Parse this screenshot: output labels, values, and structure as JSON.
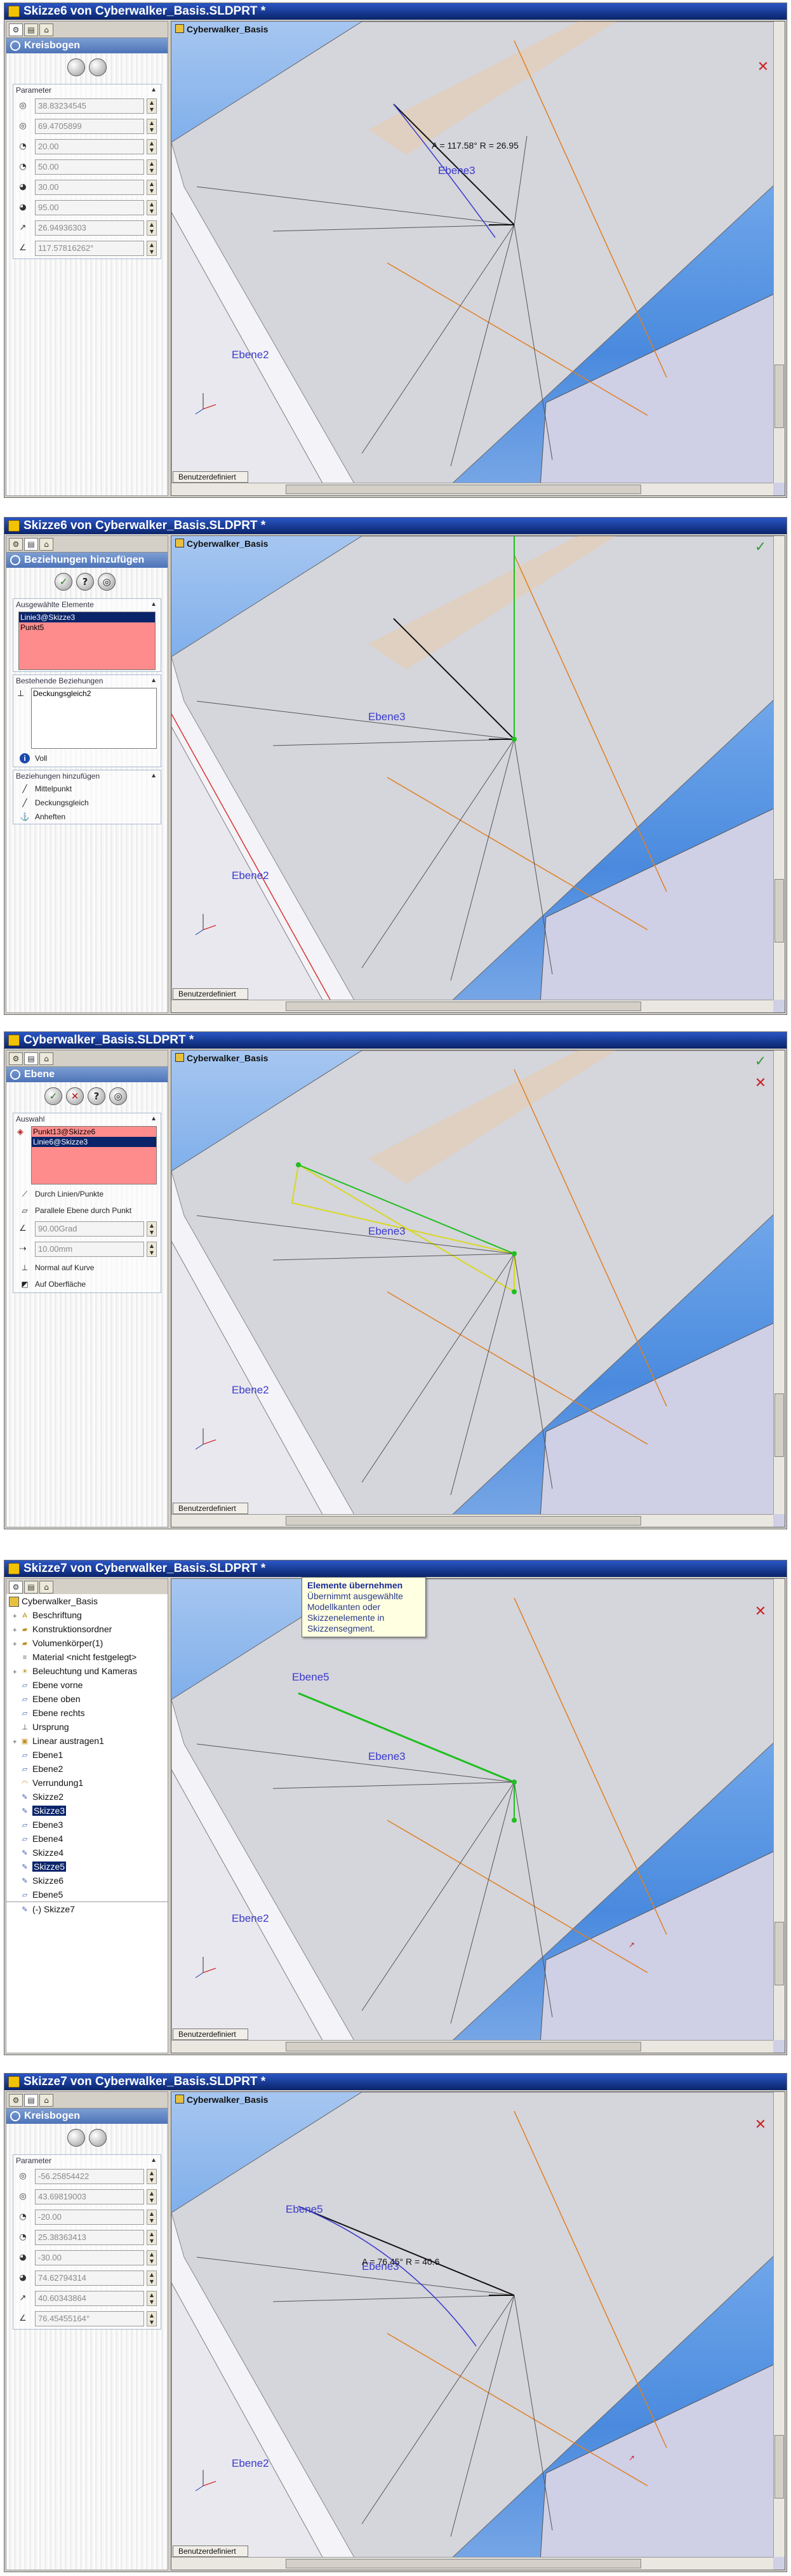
{
  "colors": {
    "title_bar": "#0a246a",
    "viewport_sky": "#6aa2e8",
    "model_gray": "#d9d9e0",
    "plane_blue": "#3a3acc",
    "sketch_orange": "#e08020",
    "selection_pink": "#ff8c8c",
    "selection_blue": "#0a246a",
    "confirm_green": "#3a9a3a",
    "cancel_red": "#cc2222"
  },
  "icons": {
    "app": "solidworks-part-icon",
    "confirm": "green-check-icon",
    "cancel": "red-x-icon",
    "help": "question-icon"
  },
  "windows": [
    {
      "title": "Skizze6 von Cyberwalker_Basis.SLDPRT *",
      "panel_title": "Kreisbogen",
      "group_title": "Parameter",
      "params": [
        "38.83234545",
        "69.4705899",
        "20.00",
        "50.00",
        "30.00",
        "95.00",
        "26.94936303",
        "117.57816262°"
      ],
      "viewport_label": "Cyberwalker_Basis",
      "dimension": "A = 117.58° R = 26.95",
      "plane_top": "Ebene3",
      "plane_bottom": "Ebene2",
      "view_tab": "Benutzerdefiniert"
    },
    {
      "title": "Skizze6 von Cyberwalker_Basis.SLDPRT *",
      "panel_title": "Beziehungen hinzufügen",
      "sel_group": "Ausgewählte Elemente",
      "sel_items": [
        "Linie3@Skizze3",
        "Punkt5"
      ],
      "exist_group": "Bestehende Beziehungen",
      "exist_items": [
        "Deckungsgleich2"
      ],
      "status": "Voll",
      "add_group": "Beziehungen hinzufügen",
      "add_items": [
        "Mittelpunkt",
        "Deckungsgleich",
        "Anheften"
      ],
      "viewport_label": "Cyberwalker_Basis",
      "plane_top": "Ebene3",
      "plane_bottom": "Ebene2",
      "view_tab": "Benutzerdefiniert"
    },
    {
      "title": "Cyberwalker_Basis.SLDPRT *",
      "panel_title": "Ebene",
      "sel_group": "Auswahl",
      "sel_items": [
        "Punkt13@Skizze6",
        "Linie6@Skizze3"
      ],
      "options": [
        "Durch Linien/Punkte",
        "Parallele Ebene durch Punkt"
      ],
      "fields": [
        "90.00Grad",
        "10.00mm"
      ],
      "options2": [
        "Normal auf Kurve",
        "Auf Oberfläche"
      ],
      "viewport_label": "Cyberwalker_Basis",
      "plane_top": "Ebene3",
      "plane_bottom": "Ebene2",
      "view_tab": "Benutzerdefiniert"
    },
    {
      "title": "Skizze7 von Cyberwalker_Basis.SLDPRT *",
      "tree": [
        "Cyberwalker_Basis",
        "Beschriftung",
        "Konstruktionsordner",
        "Volumenkörper(1)",
        "Material <nicht festgelegt>",
        "Beleuchtung und Kameras",
        "Ebene vorne",
        "Ebene oben",
        "Ebene rechts",
        "Ursprung",
        "Linear austragen1",
        "Ebene1",
        "Ebene2",
        "Verrundung1",
        "Skizze2",
        "Skizze3",
        "Ebene3",
        "Ebene4",
        "Skizze4",
        "Skizze5",
        "Skizze6",
        "Ebene5",
        "(-) Skizze7"
      ],
      "tooltip_title": "Elemente übernehmen",
      "tooltip_body": [
        "Übernimmt ausgewählte",
        "Modellkanten oder",
        "Skizzenelemente in",
        "Skizzensegment."
      ],
      "plane_top": "Ebene5",
      "plane_mid": "Ebene3",
      "plane_bottom": "Ebene2",
      "view_tab": "Benutzerdefiniert"
    },
    {
      "title": "Skizze7 von Cyberwalker_Basis.SLDPRT *",
      "panel_title": "Kreisbogen",
      "group_title": "Parameter",
      "params": [
        "-56.25854422",
        "43.69819003",
        "-20.00",
        "25.38363413",
        "-30.00",
        "74.62794314",
        "40.60343864",
        "76.45455164°"
      ],
      "viewport_label": "Cyberwalker_Basis",
      "dimension": "A = 76.45° R = 40.6",
      "plane_top": "Ebene5",
      "plane_mid": "Ebene3",
      "plane_bottom": "Ebene2",
      "view_tab": "Benutzerdefiniert"
    }
  ]
}
